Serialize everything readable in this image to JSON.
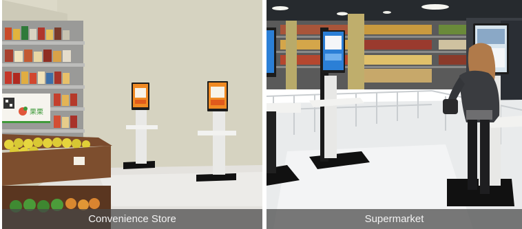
{
  "panels": [
    {
      "caption": "Convenience Store"
    },
    {
      "caption": "Supermarket"
    }
  ],
  "store_sign": {
    "brand": "果栗"
  },
  "colors": {
    "left_wall": "#dcd9c8",
    "left_floor": "#e4e2de",
    "right_ceiling": "#262a2e",
    "right_floor": "#e9ebec",
    "kiosk_screen_orange": "#f08a24",
    "kiosk_screen_blue": "#2b7fd6",
    "caption_bg": "#464646"
  }
}
